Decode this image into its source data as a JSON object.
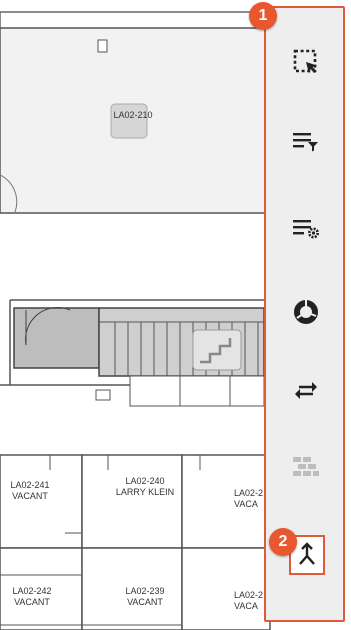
{
  "floorplan": {
    "rooms": [
      {
        "id": "LA02-210",
        "occupant": ""
      },
      {
        "id": "LA02-241",
        "occupant": "VACANT"
      },
      {
        "id": "LA02-240",
        "occupant": "LARRY KLEIN"
      },
      {
        "id": "LA02-2",
        "occupant": "VACA"
      },
      {
        "id": "LA02-242",
        "occupant": "VACANT"
      },
      {
        "id": "LA02-239",
        "occupant": "VACANT"
      },
      {
        "id": "LA02-2",
        "occupant": "VACA"
      }
    ]
  },
  "toolbar": {
    "tools": [
      {
        "icon": "select-region-icon"
      },
      {
        "icon": "filter-list-icon"
      },
      {
        "icon": "list-settings-icon"
      },
      {
        "icon": "donut-chart-icon"
      },
      {
        "icon": "swap-arrows-icon"
      },
      {
        "icon": "brick-wall-icon",
        "disabled": true
      },
      {
        "icon": "merge-icon"
      }
    ],
    "badges": [
      "1",
      "2"
    ]
  },
  "colors": {
    "accent": "#e05a3a",
    "badge": "#e8572e",
    "icon": "#222222",
    "disabled": "#bdbdbd"
  }
}
